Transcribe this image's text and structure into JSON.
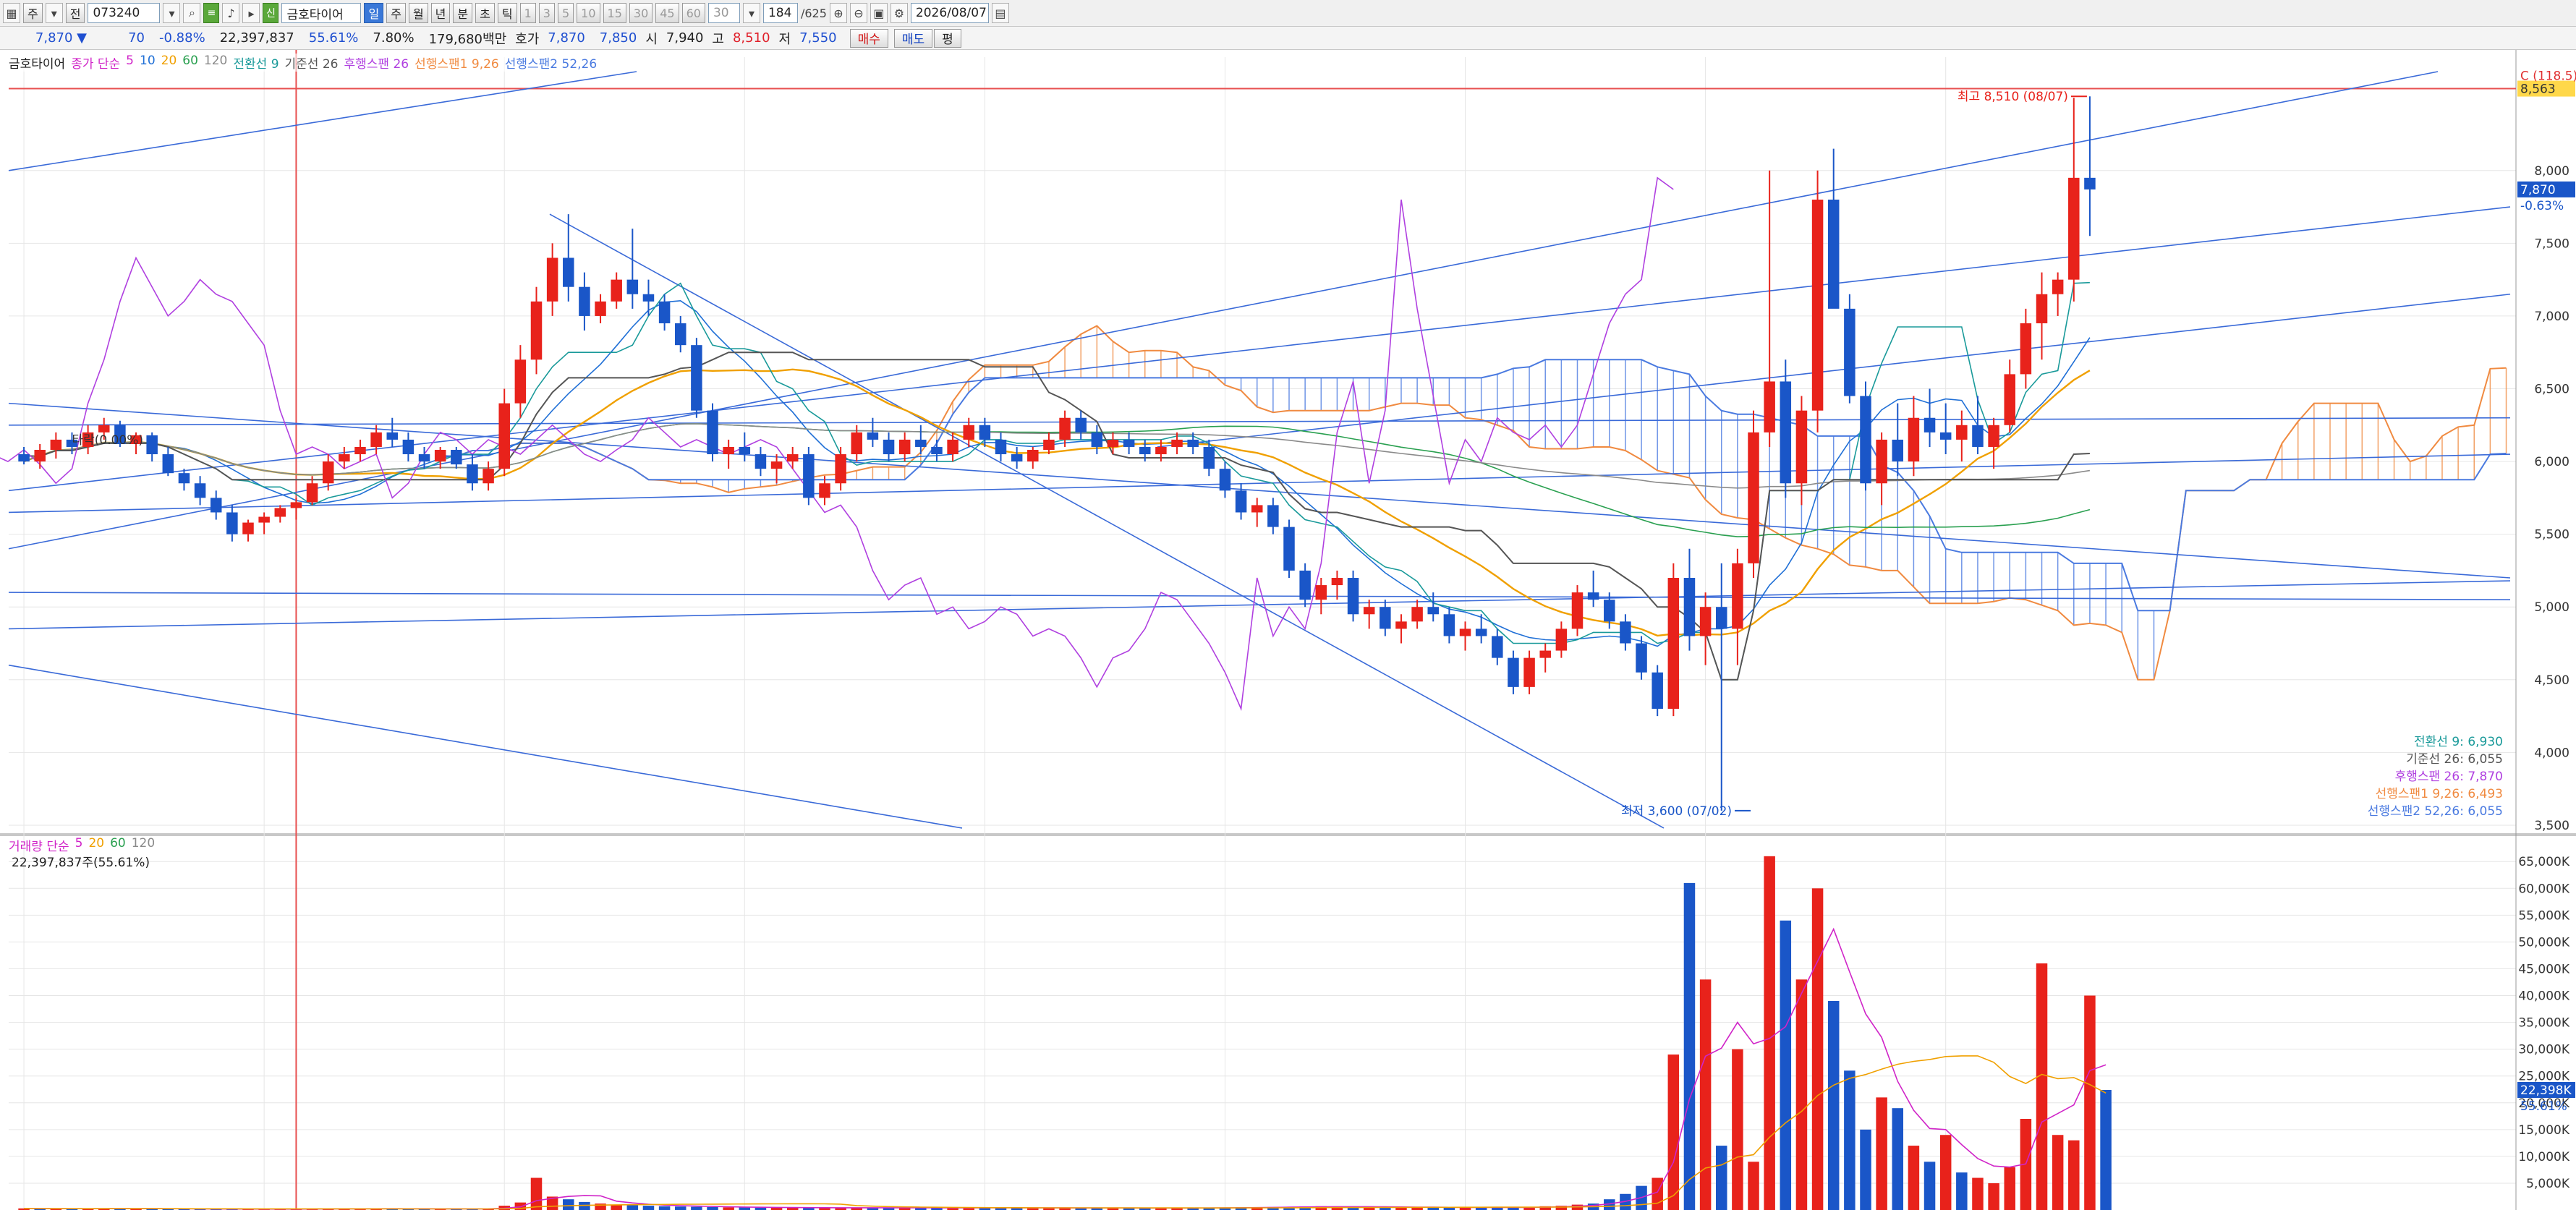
{
  "toolbar": {
    "btn_period_week": "주",
    "btn_period_full": "전",
    "code": "073240",
    "stock_name": "금호타이어",
    "periods": [
      "일",
      "주",
      "월",
      "년",
      "분",
      "초",
      "틱"
    ],
    "selected_period": "일",
    "minute_units": [
      "1",
      "3",
      "5",
      "10",
      "15",
      "30",
      "45",
      "60"
    ],
    "unit_value": "30",
    "count": "184",
    "total": "/625",
    "date": "2026/08/07"
  },
  "quote": {
    "price": "7,870",
    "change": "70",
    "change_pct": "-0.88%",
    "volume": "22,397,837",
    "volume_ratio": "55.61%",
    "turnover": "7.80%",
    "amount": "179,680백만",
    "ask_label": "호가",
    "ask": "7,870",
    "bid": "7,850",
    "open_label": "시",
    "open": "7,940",
    "high_label": "고",
    "high": "8,510",
    "low_label": "저",
    "low": "7,550",
    "buy_label": "매수",
    "sell_label": "매도",
    "eval_label": "평"
  },
  "legend": {
    "stock_name": "금호타이어",
    "ma_label": "종가 단순",
    "ma_periods": [
      "5",
      "10",
      "20",
      "60",
      "120"
    ],
    "conv_label": "전환선 9",
    "base_label": "기준선 26",
    "lag_label": "후행스팬 26",
    "lead1_label": "선행스팬1 9,26",
    "lead2_label": "선행스팬2 52,26"
  },
  "volume_legend": {
    "label": "거래량 단순",
    "ma_periods": [
      "5",
      "20",
      "60",
      "120"
    ],
    "current": "22,397,837주(55.61%)"
  },
  "colors": {
    "up": "#e8221b",
    "down": "#1a56c8",
    "ma5": "#d024c8",
    "ma10": "#1f6fd6",
    "ma20": "#f0a000",
    "ma60": "#2aa050",
    "ma120": "#8a8a8a",
    "conv": "#1a9a9a",
    "base": "#555555",
    "lag": "#b040e0",
    "cloud_up": "#f08a40",
    "cloud_down": "#4a7ae0",
    "trend": "#3a6ad8",
    "hline": "#e85050"
  },
  "chart_data": [
    {
      "type": "candlestick",
      "name": "금호타이어",
      "y_ticks": [
        3500,
        4000,
        4500,
        5000,
        5500,
        6000,
        6500,
        7000,
        7500,
        8000
      ],
      "y_tick_labels": [
        "3,500",
        "4,000",
        "4,500",
        "5,000",
        "5,500",
        "6,000",
        "6,500",
        "7,000",
        "7,500",
        "8,000"
      ],
      "ylim": [
        3450,
        8680
      ],
      "annotations": {
        "high": "최고 8,510 (08/07)",
        "low": "최저 3,600 (07/02)",
        "early": "타락(0.00%)",
        "top_tag": "8,563",
        "top_tag2": "C (118.5)",
        "price_tag": "7,870",
        "price_change": "-0.63%"
      },
      "indicator_values": [
        "전환선 9: 6,930",
        "기준선 26: 6,055",
        "후행스팬 26: 7,870",
        "선행스팬1 9,26: 6,493",
        "선행스팬2 52,26: 6,055"
      ],
      "candles": [
        [
          6050,
          6100,
          5980,
          6000
        ],
        [
          6000,
          6120,
          5950,
          6080
        ],
        [
          6080,
          6200,
          6020,
          6150
        ],
        [
          6150,
          6200,
          6050,
          6100
        ],
        [
          6100,
          6250,
          6050,
          6200
        ],
        [
          6200,
          6300,
          6150,
          6250
        ],
        [
          6250,
          6280,
          6100,
          6120
        ],
        [
          6120,
          6200,
          6050,
          6180
        ],
        [
          6180,
          6200,
          6000,
          6050
        ],
        [
          6050,
          6100,
          5900,
          5920
        ],
        [
          5920,
          5950,
          5800,
          5850
        ],
        [
          5850,
          5900,
          5700,
          5750
        ],
        [
          5750,
          5800,
          5600,
          5650
        ],
        [
          5650,
          5700,
          5450,
          5500
        ],
        [
          5500,
          5600,
          5450,
          5580
        ],
        [
          5580,
          5650,
          5500,
          5620
        ],
        [
          5620,
          5700,
          5580,
          5680
        ],
        [
          5680,
          5750,
          5600,
          5720
        ],
        [
          5720,
          5900,
          5700,
          5850
        ],
        [
          5850,
          6050,
          5800,
          6000
        ],
        [
          6000,
          6100,
          5950,
          6050
        ],
        [
          6050,
          6150,
          6000,
          6100
        ],
        [
          6100,
          6250,
          6050,
          6200
        ],
        [
          6200,
          6300,
          6100,
          6150
        ],
        [
          6150,
          6200,
          6000,
          6050
        ],
        [
          6050,
          6100,
          5950,
          6000
        ],
        [
          6000,
          6100,
          5950,
          6080
        ],
        [
          6080,
          6100,
          5950,
          5980
        ],
        [
          5980,
          6050,
          5800,
          5850
        ],
        [
          5850,
          6000,
          5800,
          5950
        ],
        [
          5950,
          6500,
          5900,
          6400
        ],
        [
          6400,
          6800,
          6300,
          6700
        ],
        [
          6700,
          7200,
          6600,
          7100
        ],
        [
          7100,
          7500,
          7000,
          7400
        ],
        [
          7400,
          7700,
          7100,
          7200
        ],
        [
          7200,
          7300,
          6900,
          7000
        ],
        [
          7000,
          7150,
          6950,
          7100
        ],
        [
          7100,
          7300,
          7050,
          7250
        ],
        [
          7250,
          7600,
          7050,
          7150
        ],
        [
          7150,
          7250,
          7000,
          7100
        ],
        [
          7100,
          7150,
          6900,
          6950
        ],
        [
          6950,
          7000,
          6750,
          6800
        ],
        [
          6800,
          6850,
          6300,
          6350
        ],
        [
          6350,
          6400,
          6000,
          6050
        ],
        [
          6050,
          6150,
          5950,
          6100
        ],
        [
          6100,
          6200,
          6000,
          6050
        ],
        [
          6050,
          6100,
          5900,
          5950
        ],
        [
          5950,
          6050,
          5850,
          6000
        ],
        [
          6000,
          6100,
          5950,
          6050
        ],
        [
          6050,
          6100,
          5700,
          5750
        ],
        [
          5750,
          5900,
          5700,
          5850
        ],
        [
          5850,
          6100,
          5800,
          6050
        ],
        [
          6050,
          6250,
          6000,
          6200
        ],
        [
          6200,
          6300,
          6100,
          6150
        ],
        [
          6150,
          6200,
          6000,
          6050
        ],
        [
          6050,
          6200,
          6000,
          6150
        ],
        [
          6150,
          6250,
          6050,
          6100
        ],
        [
          6100,
          6150,
          6000,
          6050
        ],
        [
          6050,
          6200,
          6000,
          6150
        ],
        [
          6150,
          6300,
          6100,
          6250
        ],
        [
          6250,
          6300,
          6100,
          6150
        ],
        [
          6150,
          6200,
          6000,
          6050
        ],
        [
          6050,
          6100,
          5950,
          6000
        ],
        [
          6000,
          6100,
          5950,
          6080
        ],
        [
          6080,
          6200,
          6050,
          6150
        ],
        [
          6150,
          6350,
          6100,
          6300
        ],
        [
          6300,
          6350,
          6150,
          6200
        ],
        [
          6200,
          6250,
          6050,
          6100
        ],
        [
          6100,
          6200,
          6050,
          6150
        ],
        [
          6150,
          6200,
          6050,
          6100
        ],
        [
          6100,
          6150,
          6000,
          6050
        ],
        [
          6050,
          6150,
          6000,
          6100
        ],
        [
          6100,
          6200,
          6050,
          6150
        ],
        [
          6150,
          6200,
          6050,
          6100
        ],
        [
          6100,
          6150,
          5900,
          5950
        ],
        [
          5950,
          6000,
          5750,
          5800
        ],
        [
          5800,
          5850,
          5600,
          5650
        ],
        [
          5650,
          5750,
          5550,
          5700
        ],
        [
          5700,
          5750,
          5500,
          5550
        ],
        [
          5550,
          5600,
          5200,
          5250
        ],
        [
          5250,
          5300,
          5000,
          5050
        ],
        [
          5050,
          5200,
          4950,
          5150
        ],
        [
          5150,
          5250,
          5050,
          5200
        ],
        [
          5200,
          5250,
          4900,
          4950
        ],
        [
          4950,
          5050,
          4850,
          5000
        ],
        [
          5000,
          5050,
          4800,
          4850
        ],
        [
          4850,
          4950,
          4750,
          4900
        ],
        [
          4900,
          5050,
          4850,
          5000
        ],
        [
          5000,
          5100,
          4900,
          4950
        ],
        [
          4950,
          5000,
          4750,
          4800
        ],
        [
          4800,
          4900,
          4700,
          4850
        ],
        [
          4850,
          4950,
          4750,
          4800
        ],
        [
          4800,
          4850,
          4600,
          4650
        ],
        [
          4650,
          4700,
          4400,
          4450
        ],
        [
          4450,
          4700,
          4400,
          4650
        ],
        [
          4650,
          4750,
          4550,
          4700
        ],
        [
          4700,
          4900,
          4650,
          4850
        ],
        [
          4850,
          5150,
          4800,
          5100
        ],
        [
          5100,
          5250,
          5000,
          5050
        ],
        [
          5050,
          5100,
          4850,
          4900
        ],
        [
          4900,
          4950,
          4700,
          4750
        ],
        [
          4750,
          4800,
          4500,
          4550
        ],
        [
          4550,
          4600,
          4250,
          4300
        ],
        [
          4300,
          5300,
          4250,
          5200
        ],
        [
          5200,
          5400,
          4700,
          4800
        ],
        [
          4800,
          5100,
          4600,
          5000
        ],
        [
          5000,
          5300,
          3600,
          4850
        ],
        [
          4850,
          5400,
          4600,
          5300
        ],
        [
          5300,
          6350,
          5200,
          6200
        ],
        [
          6200,
          8000,
          6100,
          6550
        ],
        [
          6550,
          6700,
          5750,
          5850
        ],
        [
          5850,
          6450,
          5700,
          6350
        ],
        [
          6350,
          8000,
          6200,
          7800
        ],
        [
          7800,
          8150,
          7200,
          7050
        ],
        [
          7050,
          7150,
          6400,
          6450
        ],
        [
          6450,
          6550,
          5800,
          5850
        ],
        [
          5850,
          6200,
          5700,
          6150
        ],
        [
          6150,
          6400,
          5900,
          6000
        ],
        [
          6000,
          6450,
          5900,
          6300
        ],
        [
          6300,
          6500,
          6100,
          6200
        ],
        [
          6200,
          6400,
          6050,
          6150
        ],
        [
          6150,
          6350,
          6000,
          6250
        ],
        [
          6250,
          6450,
          6050,
          6100
        ],
        [
          6100,
          6300,
          5950,
          6250
        ],
        [
          6250,
          6700,
          6200,
          6600
        ],
        [
          6600,
          7050,
          6500,
          6950
        ],
        [
          6950,
          7300,
          6700,
          7150
        ],
        [
          7150,
          7300,
          7000,
          7250
        ],
        [
          7250,
          8500,
          7100,
          7950
        ],
        [
          7950,
          8510,
          7550,
          7870
        ]
      ]
    },
    {
      "type": "bar",
      "name": "거래량",
      "y_ticks": [
        5000,
        10000,
        15000,
        20000,
        25000,
        30000,
        35000,
        40000,
        45000,
        50000,
        55000,
        60000,
        65000
      ],
      "y_tick_labels": [
        "5,000K",
        "10,000K",
        "15,000K",
        "20,000K",
        "25,000K",
        "30,000K",
        "35,000K",
        "40,000K",
        "45,000K",
        "50,000K",
        "55,000K",
        "60,000K",
        "65,000K"
      ],
      "ylim": [
        0,
        68000
      ],
      "current_tag": "22,398K",
      "current_pct": "55.61%",
      "values": [
        300,
        250,
        200,
        220,
        260,
        300,
        280,
        240,
        210,
        200,
        190,
        180,
        170,
        160,
        150,
        160,
        170,
        180,
        200,
        260,
        240,
        220,
        260,
        250,
        200,
        190,
        200,
        210,
        230,
        260,
        800,
        1400,
        6000,
        2500,
        2000,
        1500,
        1200,
        1000,
        900,
        800,
        700,
        650,
        600,
        550,
        500,
        480,
        460,
        440,
        430,
        420,
        410,
        400,
        420,
        430,
        410,
        400,
        390,
        380,
        400,
        420,
        410,
        400,
        380,
        370,
        380,
        400,
        390,
        380,
        370,
        360,
        350,
        360,
        370,
        380,
        400,
        450,
        500,
        520,
        550,
        600,
        650,
        700,
        600,
        580,
        560,
        540,
        520,
        500,
        480,
        470,
        460,
        450,
        480,
        500,
        520,
        700,
        800,
        1000,
        1200,
        2000,
        3000,
        4500,
        6000,
        29000,
        61000,
        43000,
        12000,
        30000,
        9000,
        66000,
        54000,
        43000,
        60000,
        39000,
        26000,
        15000,
        21000,
        19000,
        12000,
        9000,
        14000,
        7000,
        6000,
        5000,
        8000,
        17000,
        46000,
        14000,
        13000,
        40000,
        22398
      ],
      "colors_up": [
        1,
        0,
        1,
        0,
        1,
        1,
        0,
        1,
        0,
        0,
        0,
        0,
        0,
        0,
        1,
        1,
        1,
        1,
        1,
        1,
        1,
        1,
        1,
        0,
        0,
        0,
        1,
        0,
        0,
        1,
        1,
        1,
        1,
        1,
        0,
        0,
        1,
        1,
        0,
        0,
        0,
        0,
        0,
        0,
        1,
        0,
        0,
        1,
        1,
        0,
        1,
        1,
        1,
        0,
        0,
        1,
        0,
        0,
        1,
        1,
        0,
        0,
        0,
        1,
        1,
        1,
        0,
        0,
        1,
        0,
        0,
        1,
        1,
        0,
        0,
        0,
        0,
        1,
        0,
        0,
        0,
        1,
        1,
        0,
        1,
        0,
        1,
        1,
        0,
        0,
        1,
        0,
        0,
        0,
        1,
        1,
        1,
        1,
        0,
        0,
        0,
        0,
        1,
        1,
        0,
        1,
        0,
        1,
        1,
        1,
        0,
        1,
        1,
        0,
        0,
        0,
        1,
        0,
        1,
        0,
        1,
        0,
        1,
        1,
        1,
        1,
        1,
        1,
        1,
        1,
        0
      ]
    }
  ]
}
